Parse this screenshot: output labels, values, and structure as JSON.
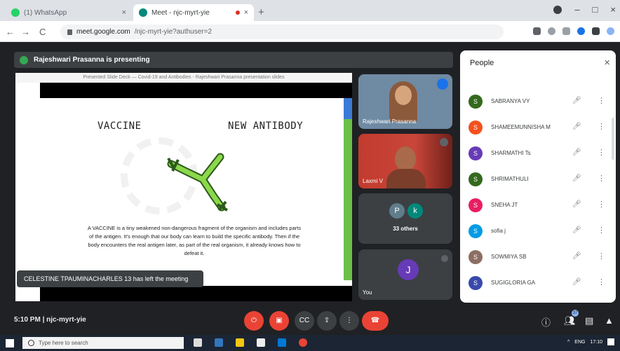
{
  "browser": {
    "tabs": [
      {
        "title": "(1) WhatsApp",
        "close": "×"
      },
      {
        "title": "Meet - njc-myrt-yie",
        "close": "×"
      }
    ],
    "new_tab": "+",
    "window_controls": {
      "minimize": "–",
      "maximize": "□",
      "close": "×"
    },
    "nav": {
      "back": "←",
      "forward": "→",
      "reload": "C"
    },
    "url_host": "meet.google.com",
    "url_path": "/njc-myrt-yie?authuser=2"
  },
  "presenting_banner": "Rajeshwari Prasanna is presenting",
  "slide": {
    "caption": "Presented Slide Deck — Covid-19 and Antibodies - Rajeshwari Prasanna presentation slides",
    "heading_left": "VACCINE",
    "heading_right": "NEW ANTIBODY",
    "paragraph": "A VACCINE is a tiny weakened non-dangerous fragment of the organism and includes parts of the antigen. It's enough that our body can learn to build the specific antibody. Then if the body encounters the real antigen later, as part of the real organism, it already knows how to defeat it."
  },
  "toast": "CELESTINE TPAUMINACHARLES 13 has left the meeting",
  "tiles": {
    "presenter_name": "Rajeshwari Prasanna",
    "tile2_name": "Laxmi V",
    "others_avatars": [
      "P",
      "k"
    ],
    "others_count": "33 others",
    "you_avatar": "J",
    "you_label": "You"
  },
  "people_panel": {
    "title": "People",
    "close": "×",
    "rows": [
      {
        "initial": "S",
        "name": "SABRANYA VY",
        "color": "#33691e"
      },
      {
        "initial": "S",
        "name": "SHAMEEMUNNISHA M",
        "color": "#f4511e"
      },
      {
        "initial": "S",
        "name": "SHARMATHI Ts",
        "color": "#673ab7"
      },
      {
        "initial": "S",
        "name": "SHRIMATHULI",
        "color": "#33691e"
      },
      {
        "initial": "S",
        "name": "SNEHA JT",
        "color": "#e91e63"
      },
      {
        "initial": "S",
        "name": "sofia j",
        "color": "#039be5"
      },
      {
        "initial": "S",
        "name": "SOWMIYA SB",
        "color": "#8d6e63"
      },
      {
        "initial": "S",
        "name": "SUGIGLORIA GA",
        "color": "#3949ab"
      }
    ],
    "mic_icon": "🎤︎",
    "kebab": "⋮"
  },
  "controls": {
    "time": "5:10 PM",
    "separator": "|",
    "meeting_code": "njc-myrt-yie",
    "buttons": {
      "mic": "⏻",
      "camera": "▣",
      "captions": "CC",
      "present": "⇪",
      "more": "⋮",
      "hangup": "☎"
    },
    "right_icons": {
      "info": "ⓘ",
      "people": "👥︎",
      "chat": "▤",
      "activities": "▲"
    },
    "participant_badge": "37"
  },
  "taskbar": {
    "search_placeholder": "Type here to search",
    "time": "17:10",
    "lang": "ENG"
  },
  "colors": {
    "meet_bg": "#202124",
    "panel_bg": "#ffffff",
    "hangup_red": "#ea4335",
    "slide_green": "#6cc04a"
  }
}
